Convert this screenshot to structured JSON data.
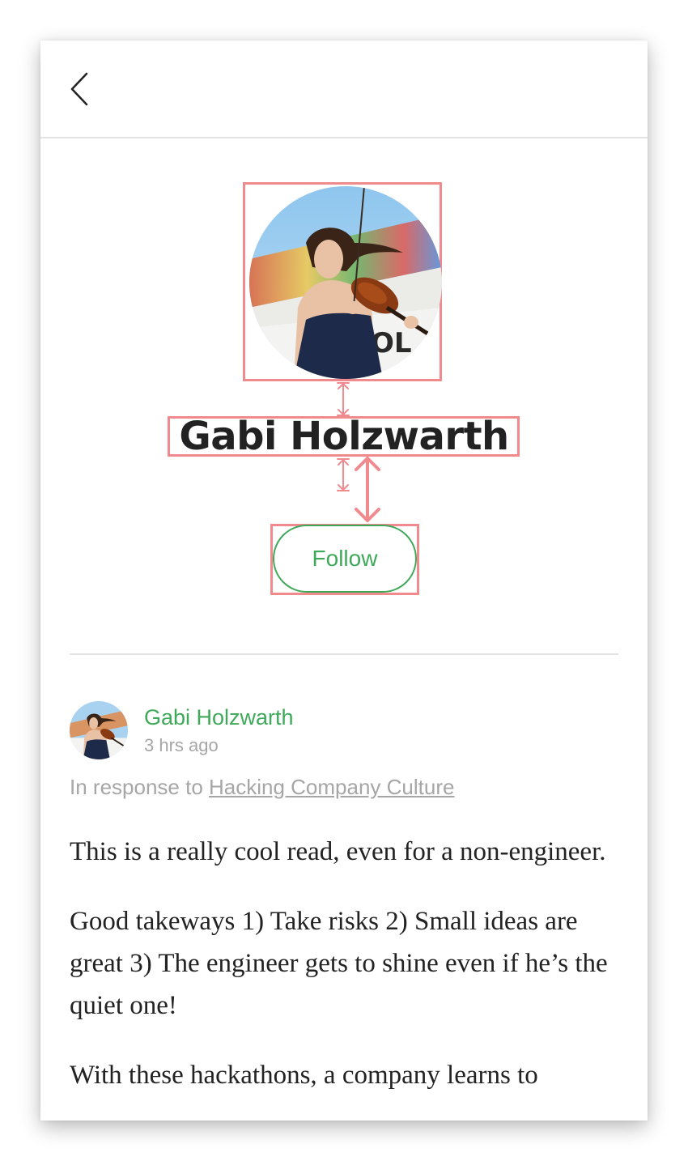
{
  "navbar": {
    "back_icon": "chevron-left-icon"
  },
  "profile": {
    "name": "Gabi Holzwarth",
    "avatar_description": "profile-photo",
    "follow_label": "Follow"
  },
  "colors": {
    "accent_green": "#3fa95a",
    "annotation_pink": "#f08a8e",
    "text_dark": "#222222",
    "text_muted": "#a6a6a6",
    "divider": "#e2e2e2"
  },
  "response": {
    "author_name": "Gabi Holzwarth",
    "time": "3 hrs ago",
    "in_response_prefix": "In response to ",
    "in_response_link": "Hacking Company Culture",
    "paragraphs": [
      "This is a really cool read, even for a non-engineer.",
      "Good takeways 1) Take risks 2) Small ideas are great 3) The engineer gets to shine even if he’s the quiet one!",
      "With these hackathons, a company learns to"
    ]
  }
}
